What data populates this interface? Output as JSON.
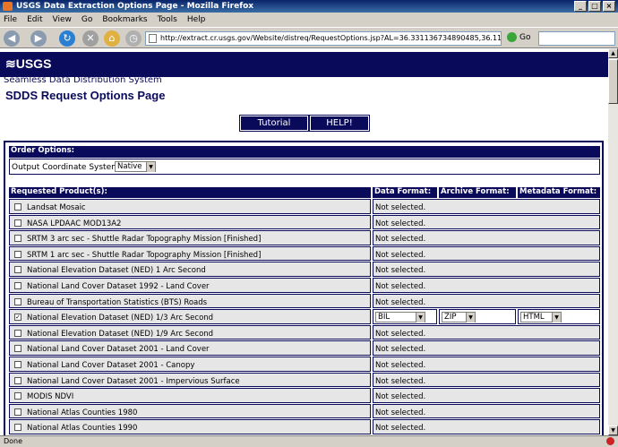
{
  "window": {
    "title": "USGS Data Extraction Options Page - Mozilla Firefox"
  },
  "menu": [
    "File",
    "Edit",
    "View",
    "Go",
    "Bookmarks",
    "Tools",
    "Help"
  ],
  "address": {
    "url": "http://extract.cr.usgs.gov/Website/distreq/RequestOptions.jsp?AL=36.331136734890485,36.1173307166888,-",
    "go_label": "Go"
  },
  "header": {
    "logo": "≋USGS",
    "subtitle": "Seamless Data Distribution System",
    "title": "SDDS Request Options Page"
  },
  "buttons": {
    "tutorial": "Tutorial",
    "help": "HELP!"
  },
  "order": {
    "header": "Order Options:",
    "coord_label": "Output Coordinate System",
    "coord_value": "Native"
  },
  "columns": {
    "product": "Requested Product(s):",
    "data": "Data Format:",
    "archive": "Archive Format:",
    "metadata": "Metadata Format:"
  },
  "not_selected": "Not selected.",
  "products": [
    {
      "name": "Landsat Mosaic",
      "checked": false
    },
    {
      "name": "NASA LPDAAC MOD13A2",
      "checked": false
    },
    {
      "name": "SRTM 3 arc sec - Shuttle Radar Topography Mission [Finished]",
      "checked": false
    },
    {
      "name": "SRTM 1 arc sec - Shuttle Radar Topography Mission [Finished]",
      "checked": false
    },
    {
      "name": "National Elevation Dataset (NED) 1 Arc Second",
      "checked": false
    },
    {
      "name": "National Land Cover Dataset 1992 - Land Cover",
      "checked": false
    },
    {
      "name": "Bureau of Transportation Statistics (BTS) Roads",
      "checked": false
    },
    {
      "name": "National Elevation Dataset (NED) 1/3 Arc Second",
      "checked": true,
      "data": "BIL",
      "archive": "ZIP",
      "metadata": "HTML"
    },
    {
      "name": "National Elevation Dataset (NED) 1/9 Arc Second",
      "checked": false
    },
    {
      "name": "National Land Cover Dataset 2001 - Land Cover",
      "checked": false
    },
    {
      "name": "National Land Cover Dataset 2001 - Canopy",
      "checked": false
    },
    {
      "name": "National Land Cover Dataset 2001 - Impervious Surface",
      "checked": false
    },
    {
      "name": "MODIS NDVI",
      "checked": false
    },
    {
      "name": "National Atlas Counties 1980",
      "checked": false
    },
    {
      "name": "National Atlas Counties 1990",
      "checked": false
    }
  ],
  "status": {
    "text": "Done"
  }
}
